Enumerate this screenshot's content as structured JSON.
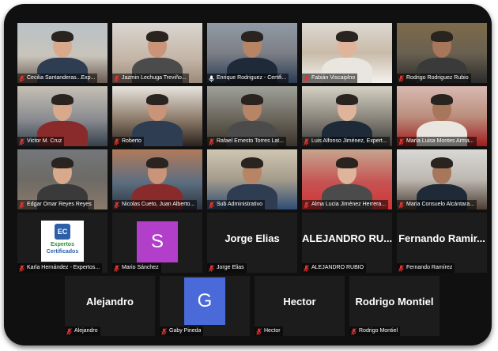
{
  "colors": {
    "frame": "#101010",
    "tile": "#1c1c1c",
    "active_speaker_border": "#b6f26a",
    "mic_muted": "#e0342f",
    "avatar_s": "#b13fca",
    "avatar_g": "#4a6ad9"
  },
  "rows": [
    {
      "tiles": [
        {
          "type": "video",
          "name": "Cecilia Santanderas...Exp...",
          "muted": true
        },
        {
          "type": "video",
          "name": "Jazmin Lechuga Treviño...",
          "muted": true
        },
        {
          "type": "video",
          "name": "Enrique Rodriguez - Certifi...",
          "muted": false
        },
        {
          "type": "video",
          "name": "Fabián Viscaiplno",
          "muted": true
        },
        {
          "type": "video",
          "name": "Rodrigo Rodriguez Rubio",
          "muted": true
        }
      ]
    },
    {
      "tiles": [
        {
          "type": "video",
          "name": "Victor M. Cruz",
          "muted": true
        },
        {
          "type": "video",
          "name": "Roberto",
          "muted": true
        },
        {
          "type": "video",
          "name": "Rafael Ernesto Torres Lat...",
          "muted": true
        },
        {
          "type": "video",
          "name": "Luis Alfonso Jiménez, Expert...",
          "muted": true,
          "active": true
        },
        {
          "type": "video",
          "name": "María Luisa Montes Arma...",
          "muted": true
        }
      ]
    },
    {
      "tiles": [
        {
          "type": "video",
          "name": "Edgar Omar Reyes Reyes",
          "muted": true
        },
        {
          "type": "video",
          "name": "Nicolas Cueto, Juan Alberto...",
          "muted": true
        },
        {
          "type": "video",
          "name": "Sub Administrativo",
          "muted": true
        },
        {
          "type": "video",
          "name": "Alma Lucia Jiménez Herrera...",
          "muted": true
        },
        {
          "type": "video",
          "name": "Maria Consuelo Alcántara...",
          "muted": true
        }
      ]
    },
    {
      "tiles": [
        {
          "type": "logo",
          "logo_initials": "EC",
          "logo_line1": "Expertos",
          "logo_line2": "Certificados",
          "name": "Karla Hernández - Expertos...",
          "muted": true
        },
        {
          "type": "avatar",
          "letter": "S",
          "color": "#b13fca",
          "name": "Mario Sánchez",
          "muted": true
        },
        {
          "type": "name",
          "display": "Jorge Elias",
          "name": "Jorge Elias",
          "muted": true
        },
        {
          "type": "name",
          "display": "ALEJANDRO  RU...",
          "name": "ALEJANDRO RUBIO",
          "muted": true
        },
        {
          "type": "name",
          "display": "Fernando  Ramir...",
          "name": "Fernando Ramírez",
          "muted": true
        }
      ]
    },
    {
      "tiles": [
        {
          "type": "name",
          "display": "Alejandro",
          "name": "Alejandro",
          "muted": true
        },
        {
          "type": "avatar",
          "letter": "G",
          "color": "#4a6ad9",
          "name": "Gaby Pineda",
          "muted": true
        },
        {
          "type": "name",
          "display": "Hector",
          "name": "Hector",
          "muted": true
        },
        {
          "type": "name",
          "display": "Rodrigo Montiel",
          "name": "Rodrigo Montiel",
          "muted": true
        }
      ]
    }
  ]
}
